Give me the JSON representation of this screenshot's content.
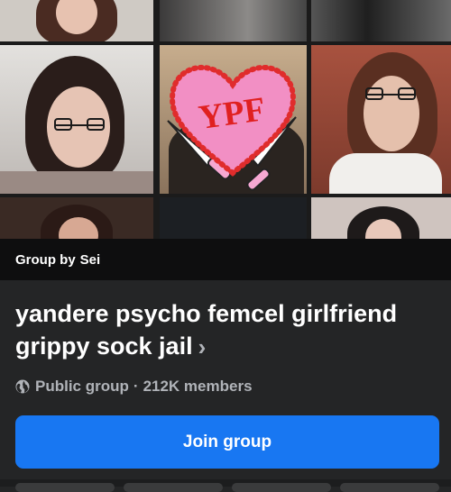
{
  "cover": {
    "logo_text": "YPF",
    "colors": {
      "heart": "#f28fc4",
      "heart_border": "#e02c2c",
      "logo_text": "#e02020",
      "knife_handle": "#f6a8d2"
    }
  },
  "group_by": {
    "label": "Group by",
    "name": "Sei"
  },
  "group": {
    "title": "yandere psycho femcel girlfriend grippy sock jail",
    "chevron": "›",
    "privacy": "Public group",
    "separator": "·",
    "members": "212K members"
  },
  "actions": {
    "join_label": "Join group"
  },
  "theme": {
    "accent": "#1877f2",
    "background": "#242526"
  }
}
